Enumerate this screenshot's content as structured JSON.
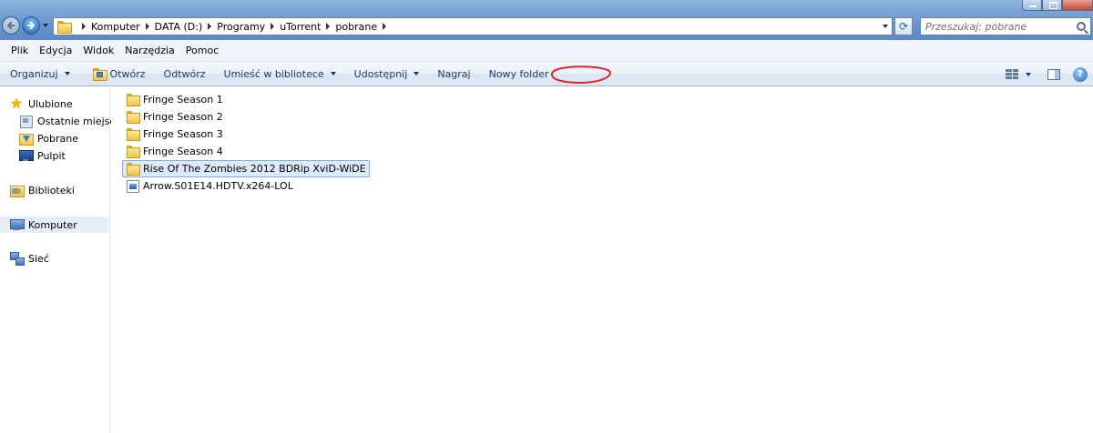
{
  "address_bar": {
    "breadcrumbs": [
      "Komputer",
      "DATA (D:)",
      "Programy",
      "uTorrent",
      "pobrane"
    ],
    "search_placeholder": "Przeszukaj: pobrane"
  },
  "menu": [
    "Plik",
    "Edycja",
    "Widok",
    "Narzędzia",
    "Pomoc"
  ],
  "toolbar": {
    "organize": "Organizuj",
    "open": "Otwórz",
    "play": "Odtwórz",
    "include_library": "Umieść w bibliotece",
    "share": "Udostępnij",
    "burn": "Nagraj",
    "new_folder": "Nowy folder"
  },
  "annotation_color": "#e0262d",
  "nav_pane": {
    "favorites": "Ulubione",
    "recent": "Ostatnie miejsca",
    "downloads": "Pobrane",
    "desktop": "Pulpit",
    "libraries": "Biblioteki",
    "computer": "Komputer",
    "network": "Sieć"
  },
  "files": [
    {
      "name": "Fringe Season 1",
      "type": "folder"
    },
    {
      "name": "Fringe Season 2",
      "type": "folder"
    },
    {
      "name": "Fringe Season 3",
      "type": "folder"
    },
    {
      "name": "Fringe Season 4",
      "type": "folder"
    },
    {
      "name": "Rise Of The Zombies 2012 BDRip XviD-WiDE",
      "type": "folder",
      "selected": true
    },
    {
      "name": "Arrow.S01E14.HDTV.x264-LOL",
      "type": "video"
    }
  ]
}
